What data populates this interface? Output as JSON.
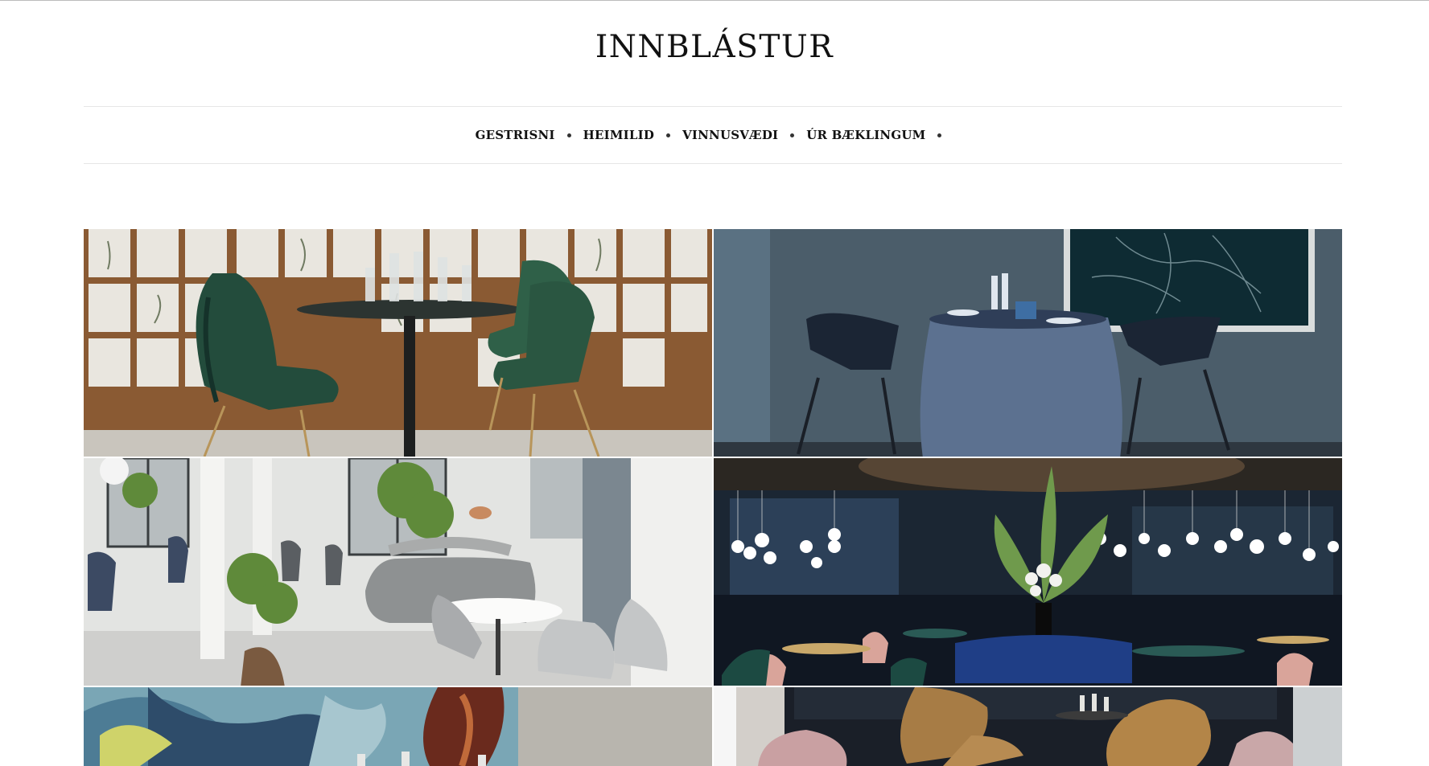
{
  "site": {
    "title": "INNBLÁSTUR"
  },
  "nav": {
    "items": [
      {
        "label": "GESTRISNI"
      },
      {
        "label": "HEIMILID"
      },
      {
        "label": "VINNUSVÆDI"
      },
      {
        "label": "ÚR BÆKLINGUM"
      }
    ]
  },
  "colors": {
    "text": "#111111",
    "rule": "#e6e6e6",
    "background": "#ffffff"
  },
  "gallery": {
    "tiles": [
      {
        "subject": "green velvet chairs around round black table in front of botanical prints"
      },
      {
        "subject": "blue tablecloth table with dark chairs and abstract artwork"
      },
      {
        "subject": "bright restaurant with grey sofa, round white table and plants"
      },
      {
        "subject": "dark blue dining room with globe pendant lights and large floral arrangement"
      },
      {
        "subject": "colourful graffiti mural wall with glassware"
      },
      {
        "subject": "lounge with pink and mustard velvet lounge chairs"
      }
    ]
  }
}
